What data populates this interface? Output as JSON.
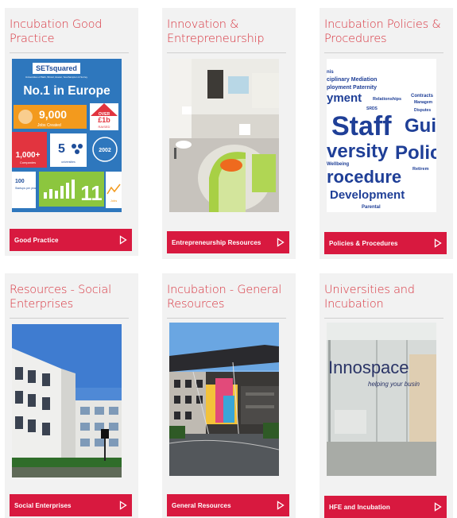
{
  "cards": [
    {
      "title": "Incubation Good Practice",
      "button": "Good Practice",
      "image": {
        "brand": "SETsquared",
        "brand_sub": "Universities of Bath, Bristol, Exeter, Southampton & Surrey",
        "headline": "No.1 in Europe",
        "jobs_value": "9,000",
        "jobs_label": "Jobs Created",
        "over_l1": "OVER",
        "over_l2": "£1b",
        "over_l3": "RAISED",
        "companies_value": "1,000+",
        "companies_label": "Companies",
        "universities_value": "5",
        "universities_label": "universities",
        "year": "2002",
        "startups_value": "100",
        "startups_label": "Startups per year",
        "count_value": "11",
        "growth_label": "Jobs"
      }
    },
    {
      "title": "Innovation & Entrepreneurship",
      "button": "Entrepreneurship Resources",
      "image": {}
    },
    {
      "title": "Incubation Policies & Procedures",
      "button": "Policies & Procedures",
      "image": {
        "words": [
          "nis",
          "ciplinary Mediation",
          "ployment Paternity",
          "yment",
          "Relationships",
          "Contracts",
          "Managem",
          "SRDS",
          "Disputes",
          "Staff",
          "Gui",
          "versity",
          "Polic",
          "Wellbeing",
          "Retirem",
          "rocedure",
          "Development",
          "Parental"
        ]
      }
    },
    {
      "title": "Resources - Social Enterprises",
      "button": "Social Enterprises",
      "image": {}
    },
    {
      "title": "Incubation - General Resources",
      "button": "General Resources",
      "image": {}
    },
    {
      "title": "Universities and Incubation",
      "button": "HFE and Incubation",
      "image": {
        "sign": "Innospace",
        "tagline": "helping your busin"
      }
    }
  ],
  "colors": {
    "accent": "#d8193f",
    "title_red": "#d8343f",
    "card_bg": "#f2f2f2"
  },
  "icons": {
    "button_arrow": "play-triangle-outline-icon"
  }
}
